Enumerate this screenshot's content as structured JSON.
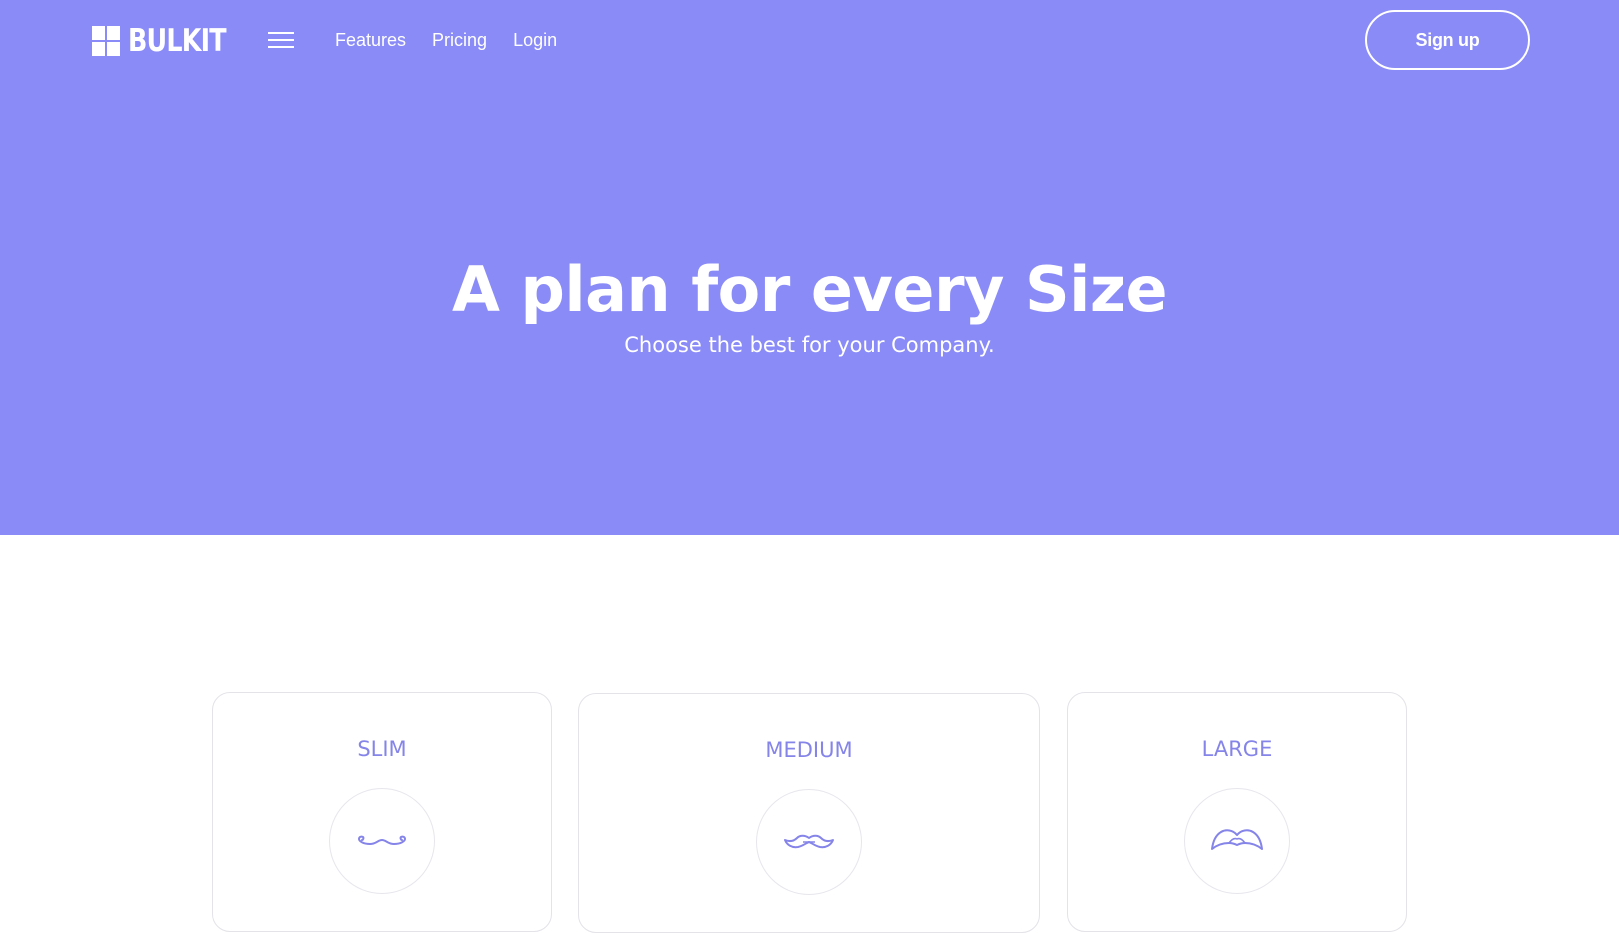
{
  "brand": {
    "name": "BULKIT"
  },
  "nav": {
    "links": [
      "Features",
      "Pricing",
      "Login"
    ],
    "signup_label": "Sign up"
  },
  "hero": {
    "title": "A plan for every Size",
    "subtitle": "Choose the best for your Company."
  },
  "plans": [
    {
      "name": "SLIM",
      "icon": "thin-mustache-icon"
    },
    {
      "name": "MEDIUM",
      "icon": "medium-mustache-icon"
    },
    {
      "name": "LARGE",
      "icon": "large-mustache-icon"
    }
  ],
  "colors": {
    "hero_bg": "#8a8bf7",
    "accent": "#8584e8",
    "text_on_hero": "#ffffff"
  }
}
